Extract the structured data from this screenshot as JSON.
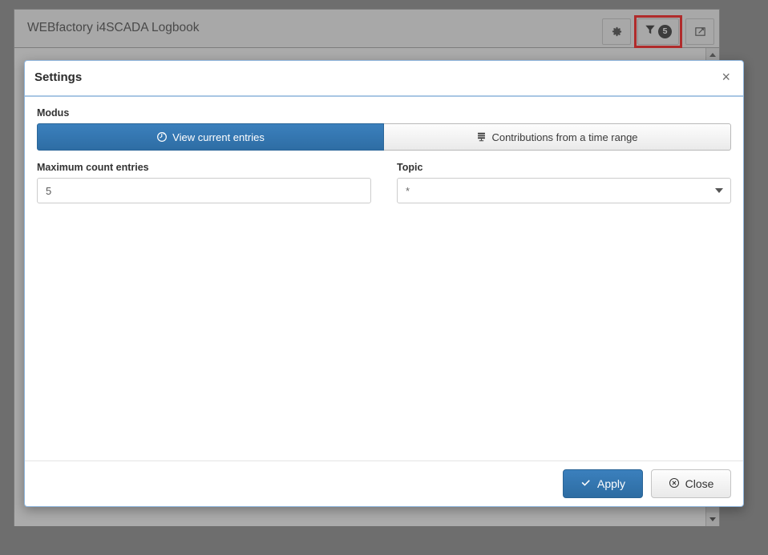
{
  "app": {
    "title": "WEBfactory i4SCADA Logbook",
    "tools": [
      {
        "name": "settings-gear",
        "icon": "gear-icon",
        "label": ""
      },
      {
        "name": "filter",
        "icon": "filter-icon",
        "badge": "5",
        "highlighted": true
      },
      {
        "name": "open-external",
        "icon": "external-window-icon",
        "label": ""
      }
    ]
  },
  "dialog": {
    "title": "Settings",
    "close_x": "×",
    "modus": {
      "label": "Modus",
      "options": [
        {
          "label": "View current entries",
          "icon": "refresh-circle-icon",
          "active": true
        },
        {
          "label": "Contributions from a time range",
          "icon": "server-stack-icon",
          "active": false
        }
      ]
    },
    "max_count": {
      "label": "Maximum count entries",
      "value": "5",
      "placeholder": "5"
    },
    "topic": {
      "label": "Topic",
      "value": "*",
      "options": [
        "*"
      ]
    },
    "footer": {
      "apply_label": "Apply",
      "close_label": "Close"
    }
  },
  "colors": {
    "primary": "#2e6da4",
    "highlight": "#ff0000",
    "badge": "#222222",
    "dialog_border": "#8fb6dd",
    "teal_tile": "#1b6579"
  }
}
